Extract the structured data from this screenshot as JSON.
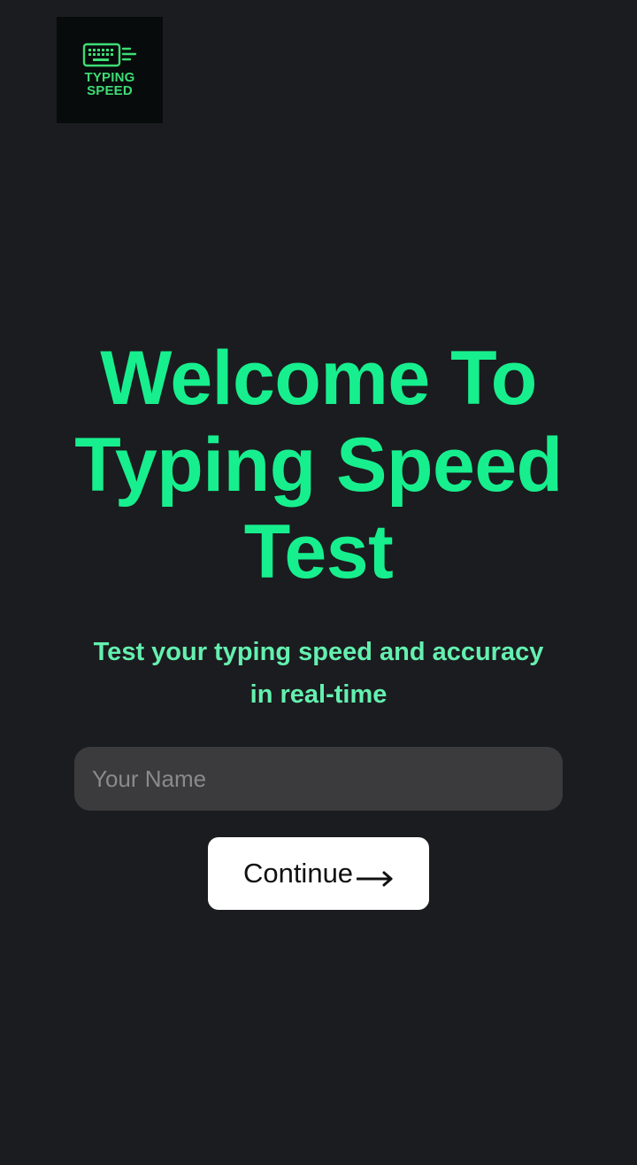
{
  "logo": {
    "icon": "keyboard-icon",
    "line1": "TYPING",
    "line2": "SPEED",
    "color": "#3ddc75"
  },
  "hero": {
    "title_line1": "Welcome To",
    "title_line2": "Typing Speed",
    "title_line3": "Test",
    "color": "#17ef8e"
  },
  "subtitle": {
    "line1": "Test your typing speed and accuracy",
    "line2": "in real-time",
    "color": "#64f0b0"
  },
  "name_input": {
    "value": "",
    "placeholder": "Your Name"
  },
  "continue_button": {
    "label": "Continue",
    "icon": "arrow-right-icon"
  },
  "theme": {
    "background": "#1b1c1f",
    "input_background": "#3b3b3d",
    "button_background": "#ffffff"
  }
}
